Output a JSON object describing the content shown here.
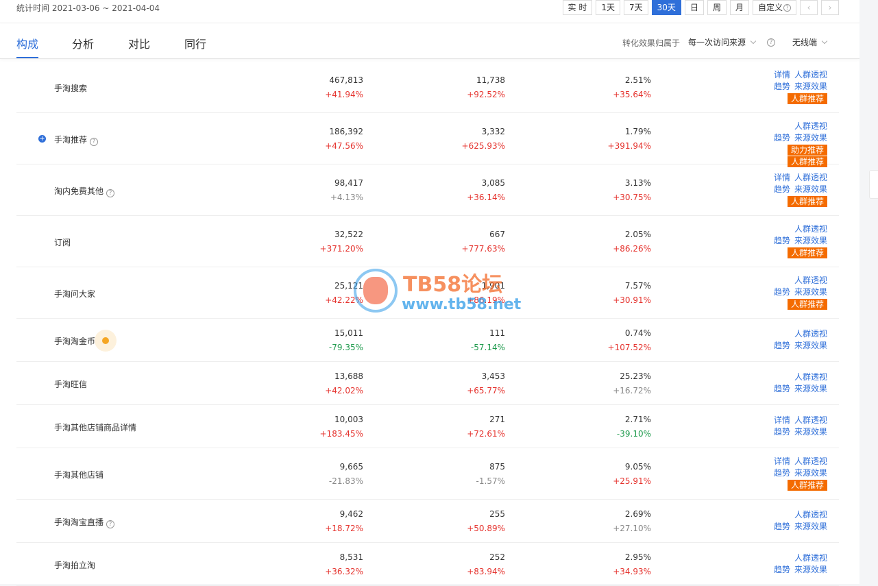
{
  "header": {
    "date_range": "统计时间 2021-03-06 ~ 2021-04-04",
    "periods": [
      "实 时",
      "1天",
      "7天",
      "30天",
      "日",
      "周",
      "月",
      "自定义"
    ],
    "active_period": "30天",
    "prev_icon": "chevron-left-icon",
    "next_icon": "chevron-right-icon"
  },
  "tabs": {
    "items": [
      "构成",
      "分析",
      "对比",
      "同行"
    ],
    "active": "构成",
    "attribution_label": "转化效果归属于",
    "attribution_value": "每一次访问来源",
    "device_value": "无线端"
  },
  "actions": {
    "detail": "详情",
    "crowd": "人群透视",
    "trend": "趋势",
    "source_effect": "来源效果",
    "crowd_recommend": "人群推荐",
    "boost_recommend": "助力推荐"
  },
  "rows": [
    {
      "name": "手淘搜索",
      "c1": "467,813",
      "c1d": "+41.94%",
      "c2": "11,738",
      "c2d": "+92.52%",
      "c3": "2.51%",
      "c3d": "+35.64%"
    },
    {
      "name": "手淘推荐",
      "c1": "186,392",
      "c1d": "+47.56%",
      "c2": "3,332",
      "c2d": "+625.93%",
      "c3": "1.79%",
      "c3d": "+391.94%"
    },
    {
      "name": "淘内免费其他",
      "c1": "98,417",
      "c1d": "+4.13%",
      "c2": "3,085",
      "c2d": "+36.14%",
      "c3": "3.13%",
      "c3d": "+30.75%"
    },
    {
      "name": "订阅",
      "c1": "32,522",
      "c1d": "+371.20%",
      "c2": "667",
      "c2d": "+777.63%",
      "c3": "2.05%",
      "c3d": "+86.26%"
    },
    {
      "name": "手淘问大家",
      "c1": "25,121",
      "c1d": "+42.22%",
      "c2": "1,901",
      "c2d": "+86.19%",
      "c3": "7.57%",
      "c3d": "+30.91%"
    },
    {
      "name": "手淘淘金币",
      "c1": "15,011",
      "c1d": "-79.35%",
      "c2": "111",
      "c2d": "-57.14%",
      "c3": "0.74%",
      "c3d": "+107.52%"
    },
    {
      "name": "手淘旺信",
      "c1": "13,688",
      "c1d": "+42.02%",
      "c2": "3,453",
      "c2d": "+65.77%",
      "c3": "25.23%",
      "c3d": "+16.72%"
    },
    {
      "name": "手淘其他店铺商品详情",
      "c1": "10,003",
      "c1d": "+183.45%",
      "c2": "271",
      "c2d": "+72.61%",
      "c3": "2.71%",
      "c3d": "-39.10%"
    },
    {
      "name": "手淘其他店铺",
      "c1": "9,665",
      "c1d": "-21.83%",
      "c2": "875",
      "c2d": "-1.57%",
      "c3": "9.05%",
      "c3d": "+25.91%"
    },
    {
      "name": "手淘淘宝直播",
      "c1": "9,462",
      "c1d": "+18.72%",
      "c2": "255",
      "c2d": "+50.89%",
      "c3": "2.69%",
      "c3d": "+27.10%"
    },
    {
      "name": "手淘拍立淘",
      "c1": "8,531",
      "c1d": "+36.32%",
      "c2": "252",
      "c2d": "+83.94%",
      "c3": "2.95%",
      "c3d": "+34.93%"
    }
  ],
  "watermark": {
    "title": "TB58论坛",
    "url": "www.tb58.net"
  },
  "colors": {
    "accent": "#2f6fd9",
    "up": "#e5322d",
    "down": "#1e9a4c",
    "tag": "#f46b00"
  }
}
